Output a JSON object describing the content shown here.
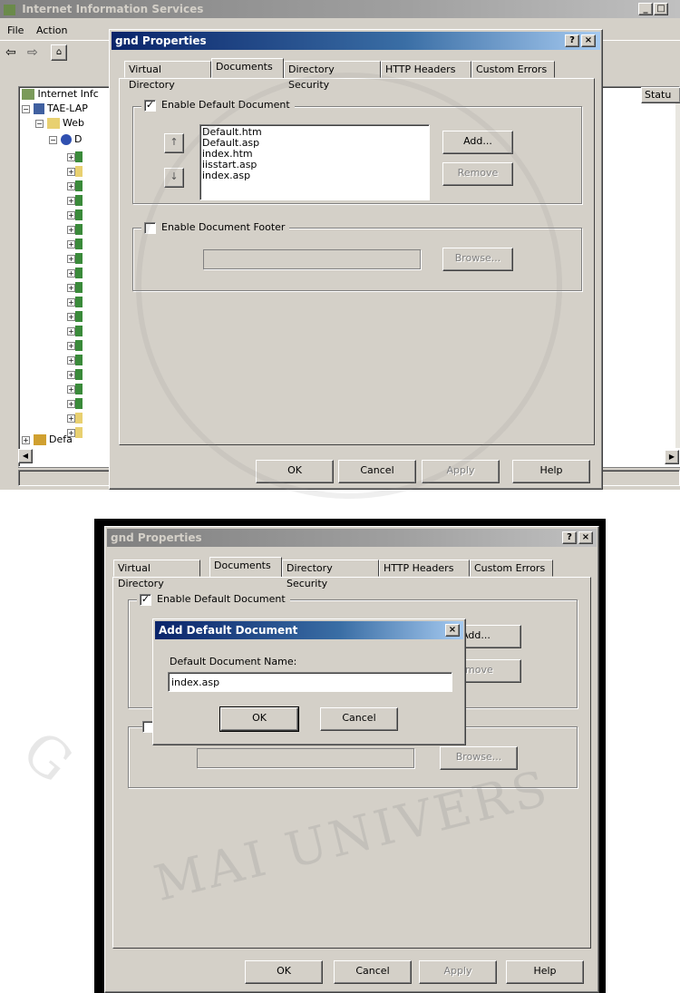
{
  "iis_window": {
    "title": "Internet Information Services",
    "menu": [
      "File",
      "Action"
    ],
    "tree": {
      "root": "Internet Infc",
      "server": "TAE-LAP",
      "web": "Web",
      "default_site_short": "D",
      "default_smtp": "Defa"
    },
    "column_header": "Statu"
  },
  "props_dialog_top": {
    "title": "gnd Properties",
    "tabs": [
      "Virtual Directory",
      "Documents",
      "Directory Security",
      "HTTP Headers",
      "Custom Errors"
    ],
    "active_tab": "Documents",
    "enable_default_doc_label": "Enable Default Document",
    "enable_default_doc_checked": true,
    "default_documents": [
      "Default.htm",
      "Default.asp",
      "index.htm",
      "iisstart.asp",
      "index.asp"
    ],
    "add_label": "Add...",
    "remove_label": "Remove",
    "enable_footer_label": "Enable Document Footer",
    "enable_footer_checked": false,
    "browse_label": "Browse...",
    "ok_label": "OK",
    "cancel_label": "Cancel",
    "apply_label": "Apply",
    "help_label": "Help",
    "help_caption": "?",
    "close_caption": "×"
  },
  "props_dialog_bottom": {
    "title": "gnd Properties",
    "tabs": [
      "Virtual Directory",
      "Documents",
      "Directory Security",
      "HTTP Headers",
      "Custom Errors"
    ],
    "enable_default_doc_label": "Enable Default Document",
    "add_label_partial": "Add...",
    "remove_label_partial": "emove",
    "browse_label": "Browse...",
    "ok_label": "OK",
    "cancel_label": "Cancel",
    "apply_label": "Apply",
    "help_label": "Help",
    "help_caption": "?",
    "close_caption": "×"
  },
  "add_doc_dialog": {
    "title": "Add Default Document",
    "field_label": "Default Document Name:",
    "field_value": "index.asp",
    "ok_label": "OK",
    "cancel_label": "Cancel",
    "close_caption": "×"
  },
  "watermark": {
    "text": "MAI UNIVERS",
    "text2": "G"
  },
  "colors": {
    "title_active": "#0a246a",
    "face": "#d4d0c8"
  }
}
